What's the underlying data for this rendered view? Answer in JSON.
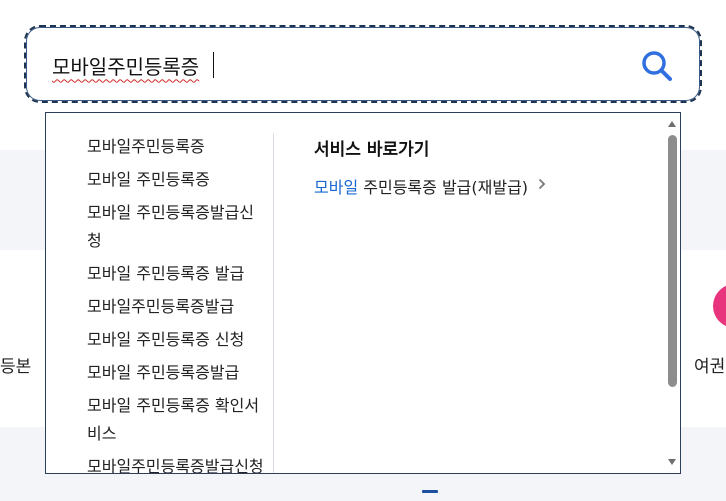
{
  "search": {
    "value": "모바일주민등록증",
    "button_icon": "search-icon",
    "accent_color": "#2f6fe0"
  },
  "suggestions": {
    "items": [
      "모바일주민등록증",
      "모바일 주민등록증",
      "모바일 주민등록증발급신청",
      "모바일 주민등록증 발급",
      "모바일주민등록증발급",
      "모바일 주민등록증 신청",
      "모바일 주민등록증발급",
      "모바일 주민등록증 확인서비스",
      "모바일주민등록증발급신청"
    ]
  },
  "service_shortcut": {
    "title": "서비스 바로가기",
    "link_highlight": "모바일",
    "link_rest": " 주민등록증 발급(재발급)",
    "link_icon": "chevron-right-icon",
    "highlight_color": "#1a67d2"
  },
  "background": {
    "left_text": "등본",
    "right_text": "여권"
  }
}
